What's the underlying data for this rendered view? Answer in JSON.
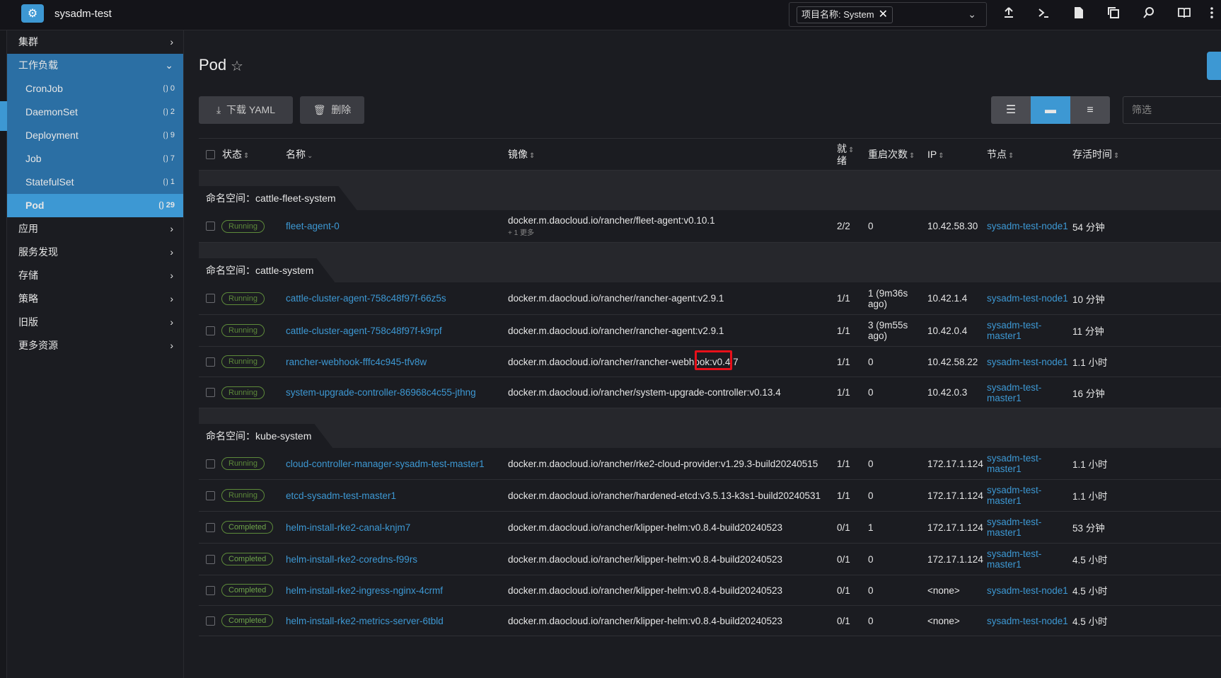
{
  "header": {
    "cluster_name": "sysadm-test",
    "ns_chip_label": "项目名称: System",
    "ns_chip_remove": "✕",
    "ns_caret": "⌄",
    "icons": [
      "upload-icon",
      "terminal-icon",
      "file-icon",
      "copy-icon",
      "search-icon",
      "book-icon",
      "more-icon"
    ]
  },
  "sidebar": {
    "groups_top": [
      {
        "label": "集群"
      }
    ],
    "workload_label": "工作负载",
    "workloads": [
      {
        "label": "CronJob",
        "count": "0"
      },
      {
        "label": "DaemonSet",
        "count": "2"
      },
      {
        "label": "Deployment",
        "count": "9"
      },
      {
        "label": "Job",
        "count": "7"
      },
      {
        "label": "StatefulSet",
        "count": "1"
      },
      {
        "label": "Pod",
        "count": "29"
      }
    ],
    "groups_bottom": [
      {
        "label": "应用"
      },
      {
        "label": "服务发现"
      },
      {
        "label": "存储"
      },
      {
        "label": "策略"
      },
      {
        "label": "旧版"
      },
      {
        "label": "更多资源"
      }
    ]
  },
  "main": {
    "title": "Pod",
    "download_label": "下载 YAML",
    "delete_label": "删除",
    "filter_placeholder": "筛选",
    "columns": {
      "state": "状态",
      "name": "名称",
      "image": "镜像",
      "ready_1": "就",
      "ready_2": "绪",
      "restarts": "重启次数",
      "ip": "IP",
      "node": "节点",
      "age": "存活时间"
    },
    "ns_prefix": "命名空间：",
    "more_label": "+ 1 更多",
    "groups": [
      {
        "namespace": "cattle-fleet-system",
        "rows": [
          {
            "state": "Running",
            "name": "fleet-agent-0",
            "image": "docker.m.daocloud.io/rancher/fleet-agent:v0.10.1",
            "ready": "2/2",
            "restarts_1": "0",
            "restarts_2": "",
            "ip": "10.42.58.30",
            "node_1": "sysadm-test-node1",
            "node_2": "",
            "age": "54 分钟"
          }
        ]
      },
      {
        "namespace": "cattle-system",
        "rows": [
          {
            "state": "Running",
            "name": "cattle-cluster-agent-758c48f97f-66z5s",
            "image": "docker.m.daocloud.io/rancher/rancher-agent:v2.9.1",
            "ready": "1/1",
            "restarts_1": "1 (9m36s",
            "restarts_2": "ago)",
            "ip": "10.42.1.4",
            "node_1": "sysadm-test-node1",
            "node_2": "",
            "age": "10 分钟"
          },
          {
            "state": "Running",
            "name": "cattle-cluster-agent-758c48f97f-k9rpf",
            "image": "docker.m.daocloud.io/rancher/rancher-agent:v2.9.1",
            "ready": "1/1",
            "restarts_1": "3 (9m55s",
            "restarts_2": "ago)",
            "ip": "10.42.0.4",
            "node_1": "sysadm-test-",
            "node_2": "master1",
            "age": "11 分钟"
          },
          {
            "state": "Running",
            "name": "rancher-webhook-fffc4c945-tfv8w",
            "image": "docker.m.daocloud.io/rancher/rancher-webhook:v0.4.7",
            "ready": "1/1",
            "restarts_1": "0",
            "restarts_2": "",
            "ip": "10.42.58.22",
            "node_1": "sysadm-test-node1",
            "node_2": "",
            "age": "1.1 小时"
          },
          {
            "state": "Running",
            "name": "system-upgrade-controller-86968c4c55-jthng",
            "image": "docker.m.daocloud.io/rancher/system-upgrade-controller:v0.13.4",
            "ready": "1/1",
            "restarts_1": "0",
            "restarts_2": "",
            "ip": "10.42.0.3",
            "node_1": "sysadm-test-",
            "node_2": "master1",
            "age": "16 分钟"
          }
        ]
      },
      {
        "namespace": "kube-system",
        "rows": [
          {
            "state": "Running",
            "name": "cloud-controller-manager-sysadm-test-master1",
            "image": "docker.m.daocloud.io/rancher/rke2-cloud-provider:v1.29.3-build20240515",
            "ready": "1/1",
            "restarts_1": "0",
            "restarts_2": "",
            "ip": "172.17.1.124",
            "node_1": "sysadm-test-",
            "node_2": "master1",
            "age": "1.1 小时"
          },
          {
            "state": "Running",
            "name": "etcd-sysadm-test-master1",
            "image": "docker.m.daocloud.io/rancher/hardened-etcd:v3.5.13-k3s1-build20240531",
            "ready": "1/1",
            "restarts_1": "0",
            "restarts_2": "",
            "ip": "172.17.1.124",
            "node_1": "sysadm-test-",
            "node_2": "master1",
            "age": "1.1 小时"
          },
          {
            "state": "Completed",
            "name": "helm-install-rke2-canal-knjm7",
            "image": "docker.m.daocloud.io/rancher/klipper-helm:v0.8.4-build20240523",
            "ready": "0/1",
            "restarts_1": "1",
            "restarts_2": "",
            "ip": "172.17.1.124",
            "node_1": "sysadm-test-",
            "node_2": "master1",
            "age": "53 分钟"
          },
          {
            "state": "Completed",
            "name": "helm-install-rke2-coredns-f99rs",
            "image": "docker.m.daocloud.io/rancher/klipper-helm:v0.8.4-build20240523",
            "ready": "0/1",
            "restarts_1": "0",
            "restarts_2": "",
            "ip": "172.17.1.124",
            "node_1": "sysadm-test-",
            "node_2": "master1",
            "age": "4.5 小时"
          },
          {
            "state": "Completed",
            "name": "helm-install-rke2-ingress-nginx-4crmf",
            "image": "docker.m.daocloud.io/rancher/klipper-helm:v0.8.4-build20240523",
            "ready": "0/1",
            "restarts_1": "0",
            "restarts_2": "",
            "ip": "<none>",
            "node_1": "sysadm-test-node1",
            "node_2": "",
            "age": "4.5 小时"
          },
          {
            "state": "Completed",
            "name": "helm-install-rke2-metrics-server-6tbld",
            "image": "docker.m.daocloud.io/rancher/klipper-helm:v0.8.4-build20240523",
            "ready": "0/1",
            "restarts_1": "0",
            "restarts_2": "",
            "ip": "<none>",
            "node_1": "sysadm-test-node1",
            "node_2": "",
            "age": "4.5 小时"
          }
        ]
      }
    ]
  },
  "colors": {
    "accent": "#3d98d3",
    "running": "#5d8a3a",
    "highlight": "#e8101a"
  }
}
